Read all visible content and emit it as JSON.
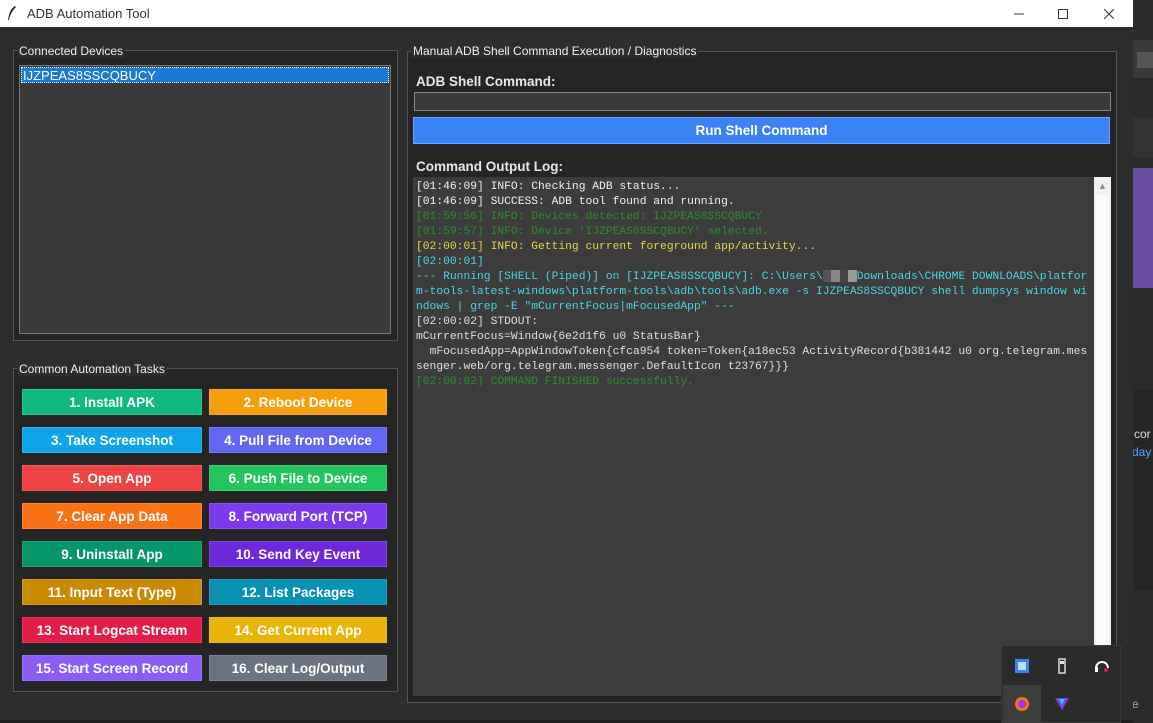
{
  "window": {
    "title": "ADB Automation Tool",
    "icons": {
      "app": "feather-icon",
      "minimize": "minimize-icon",
      "maximize": "maximize-icon",
      "close": "close-icon"
    }
  },
  "devices": {
    "group_label": "Connected Devices",
    "items": [
      "IJZPEAS8SSCQBUCY"
    ]
  },
  "tasks": {
    "group_label": "Common Automation Tasks",
    "buttons": [
      {
        "label": "1. Install APK",
        "color": "#10b981"
      },
      {
        "label": "2. Reboot Device",
        "color": "#f59e0b"
      },
      {
        "label": "3. Take Screenshot",
        "color": "#0ea5e9"
      },
      {
        "label": "4. Pull File from Device",
        "color": "#6366f1"
      },
      {
        "label": "5. Open App",
        "color": "#ef4444"
      },
      {
        "label": "6. Push File to Device",
        "color": "#22c55e"
      },
      {
        "label": "7. Clear App Data",
        "color": "#f97316"
      },
      {
        "label": "8. Forward Port (TCP)",
        "color": "#7c3aed"
      },
      {
        "label": "9. Uninstall App",
        "color": "#059669"
      },
      {
        "label": "10. Send Key Event",
        "color": "#6d28d9"
      },
      {
        "label": "11. Input Text (Type)",
        "color": "#ca8a04"
      },
      {
        "label": "12. List Packages",
        "color": "#0891b2"
      },
      {
        "label": "13. Start Logcat Stream",
        "color": "#e11d48"
      },
      {
        "label": "14. Get Current App",
        "color": "#eab308"
      },
      {
        "label": "15. Start Screen Record",
        "color": "#8b5cf6"
      },
      {
        "label": "16. Clear Log/Output",
        "color": "#6b7280"
      }
    ]
  },
  "shell": {
    "group_label": "Manual ADB Shell Command Execution / Diagnostics",
    "command_label": "ADB Shell Command:",
    "command_value": "",
    "run_label": "Run Shell Command",
    "run_color": "#3b82f6",
    "log_label": "Command Output Log:"
  },
  "log": [
    {
      "text": "[01:46:09] INFO: Checking ADB status...",
      "color": "white"
    },
    {
      "text": "[01:46:09] SUCCESS: ADB tool found and running.",
      "color": "white"
    },
    {
      "text": "[01:59:56] INFO: Devices detected: IJZPEAS8SSCQBUCY",
      "color": "green"
    },
    {
      "text": "[01:59:57] INFO: Device 'IJZPEAS8SSCQBUCY' selected.",
      "color": "green"
    },
    {
      "text": "[02:00:01] INFO: Getting current foreground app/activity...",
      "color": "yellow"
    },
    {
      "text": "[02:00:01]",
      "color": "cyan"
    },
    {
      "text": "--- Running [SHELL (Piped)] on [IJZPEAS8SSCQBUCY]: C:\\Users\\",
      "color": "cyan",
      "mosaic": true,
      "after": "Downloads\\CHROME DOWNLOADS\\platform-tools-latest-windows\\platform-tools\\adb\\tools\\adb.exe -s IJZPEAS8SSCQBUCY shell dumpsys window windows | grep -E \"mCurrentFocus|mFocusedApp\" ---"
    },
    {
      "text": "[02:00:02] STDOUT:",
      "color": "gray"
    },
    {
      "text": "mCurrentFocus=Window{6e2d1f6 u0 StatusBar}",
      "color": "gray"
    },
    {
      "text": "  mFocusedApp=AppWindowToken{cfca954 token=Token{a18ec53 ActivityRecord{b381442 u0 org.telegram.messenger.web/org.telegram.messenger.DefaultIcon t23767}}}",
      "color": "gray"
    },
    {
      "text": "[02:00:02] COMMAND FINISHED successfully.",
      "color": "green"
    }
  ],
  "tray": {
    "icons": [
      "network-icon",
      "usb-drive-icon",
      "headset-icon",
      "firefox-icon",
      "vpn-shield-icon"
    ]
  },
  "background": {
    "text1": "cor",
    "text2": "day",
    "text3": "e"
  }
}
